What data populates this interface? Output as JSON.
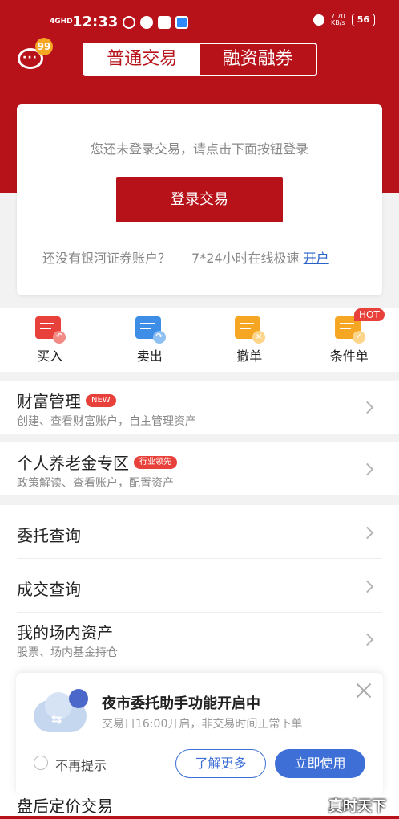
{
  "status_bar": {
    "signal": "4GHD",
    "time": "12:33",
    "net_speed": "7.70",
    "net_unit": "KB/s",
    "battery": "56"
  },
  "header": {
    "message_badge": "99",
    "tabs": [
      {
        "label": "普通交易",
        "active": true
      },
      {
        "label": "融资融券",
        "active": false
      }
    ]
  },
  "login_card": {
    "hint": "您还未登录交易，请点击下面按钮登录",
    "login_button": "登录交易",
    "no_account_text": "还没有银河证券账户？",
    "online_text": "7*24小时在线极速",
    "open_link": "开户"
  },
  "actions": [
    {
      "label": "买入",
      "icon": "buy-icon",
      "color": "#e8403a"
    },
    {
      "label": "卖出",
      "icon": "sell-icon",
      "color": "#3e8ee8"
    },
    {
      "label": "撤单",
      "icon": "cancel-order-icon",
      "color": "#f5a623"
    },
    {
      "label": "条件单",
      "icon": "conditional-order-icon",
      "color": "#f5a623"
    }
  ],
  "hot_badge": "HOT",
  "menu": {
    "wealth": {
      "title": "财富管理",
      "tag": "NEW",
      "sub": "创建、查看财富账户，自主管理资产"
    },
    "pension": {
      "title": "个人养老金专区",
      "tag": "行业领先",
      "sub": "政策解读、查看账户，配置资产"
    },
    "order_query": {
      "title": "委托查询"
    },
    "deal_query": {
      "title": "成交查询"
    },
    "assets": {
      "title": "我的场内资产",
      "sub": "股票、场内基金持仓"
    },
    "after_hours": {
      "title": "盘后定价交易"
    }
  },
  "popup": {
    "title": "夜市委托助手功能开启中",
    "sub": "交易日16:00开启，非交易时间正常下单",
    "dont_remind": "不再提示",
    "learn_more": "了解更多",
    "use_now": "立即使用"
  },
  "watermark": "真时天下",
  "colors": {
    "brand_red": "#b7121a",
    "link_blue": "#2a63c8",
    "popup_blue": "#3e6fd6"
  }
}
